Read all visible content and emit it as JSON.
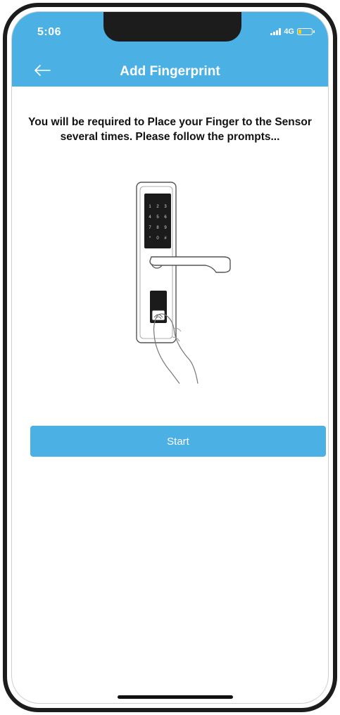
{
  "status_bar": {
    "time": "5:06",
    "network": "4G"
  },
  "header": {
    "title": "Add Fingerprint",
    "back_icon": "arrow-left-icon"
  },
  "main": {
    "instruction": "You will be required to Place your Finger to the Sensor several times. Please follow the prompts...",
    "keypad_keys": [
      "1",
      "2",
      "3",
      "4",
      "5",
      "6",
      "7",
      "8",
      "9",
      "*",
      "0",
      "#"
    ],
    "start_label": "Start"
  },
  "colors": {
    "accent": "#4bb0e4",
    "battery_low": "#f2d01e"
  }
}
